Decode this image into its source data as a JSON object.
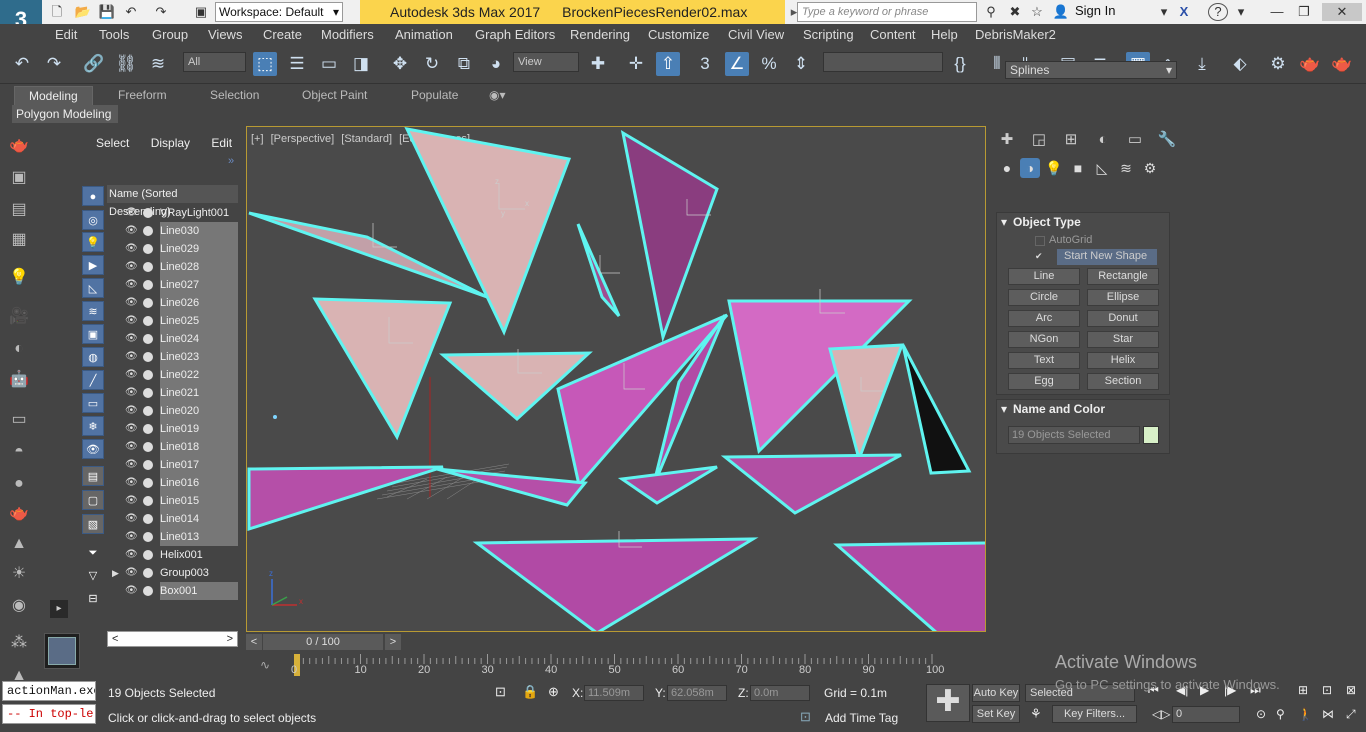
{
  "app": {
    "logo_text": "3",
    "title": "Autodesk 3ds Max 2017",
    "file": "BrockenPiecesRender02.max",
    "workspace": "Workspace: Default",
    "search_placeholder": "Type a keyword or phrase",
    "sign_in": "Sign In",
    "help": "?"
  },
  "menubar": [
    "Edit",
    "Tools",
    "Group",
    "Views",
    "Create",
    "Modifiers",
    "Animation",
    "Graph Editors",
    "Rendering",
    "Customize",
    "Civil View",
    "Scripting",
    "Content",
    "Help",
    "DebrisMaker2"
  ],
  "toolbar": {
    "selection_filter": "All",
    "ref_coord": "View",
    "named_selection": ""
  },
  "ribbon": {
    "tabs": [
      "Modeling",
      "Freeform",
      "Selection",
      "Object Paint",
      "Populate"
    ],
    "active_tab": "Modeling",
    "sub_tab": "Polygon Modeling"
  },
  "scene_explorer": {
    "tabs": [
      "Select",
      "Display",
      "Edit"
    ],
    "header": "Name (Sorted Descending)",
    "rows": [
      {
        "name": "VRayLight001",
        "selected": false
      },
      {
        "name": "Line030",
        "selected": true
      },
      {
        "name": "Line029",
        "selected": true
      },
      {
        "name": "Line028",
        "selected": true
      },
      {
        "name": "Line027",
        "selected": true
      },
      {
        "name": "Line026",
        "selected": true
      },
      {
        "name": "Line025",
        "selected": true
      },
      {
        "name": "Line024",
        "selected": true
      },
      {
        "name": "Line023",
        "selected": true
      },
      {
        "name": "Line022",
        "selected": true
      },
      {
        "name": "Line021",
        "selected": true
      },
      {
        "name": "Line020",
        "selected": true
      },
      {
        "name": "Line019",
        "selected": true
      },
      {
        "name": "Line018",
        "selected": true
      },
      {
        "name": "Line017",
        "selected": true
      },
      {
        "name": "Line016",
        "selected": true
      },
      {
        "name": "Line015",
        "selected": true
      },
      {
        "name": "Line014",
        "selected": true
      },
      {
        "name": "Line013",
        "selected": true
      },
      {
        "name": "Helix001",
        "selected": false
      },
      {
        "name": "Group003",
        "selected": false
      },
      {
        "name": "Box001",
        "selected": true
      }
    ]
  },
  "viewport": {
    "labels": [
      "[+]",
      "[Perspective]",
      "[Standard]",
      "[Edged Faces]"
    ],
    "axis_x": "x",
    "axis_y": "y",
    "axis_z": "z"
  },
  "command_panel": {
    "category": "Splines",
    "object_type_title": "Object Type",
    "autogrid": "AutoGrid",
    "start_new_shape": "Start New Shape",
    "buttons": [
      "Line",
      "Rectangle",
      "Circle",
      "Ellipse",
      "Arc",
      "Donut",
      "NGon",
      "Star",
      "Text",
      "Helix",
      "Egg",
      "Section"
    ],
    "name_color_title": "Name and Color",
    "name_value": "19 Objects Selected",
    "color": "#d8f0c8"
  },
  "timeline": {
    "frame_display": "0 / 100",
    "ticks": [
      "0",
      "10",
      "20",
      "30",
      "40",
      "50",
      "60",
      "70",
      "80",
      "90",
      "100"
    ]
  },
  "status": {
    "maxscript_line1": "actionMan.exe",
    "maxscript_line2": "-- In top-le",
    "selection": "19 Objects Selected",
    "prompt": "Click or click-and-drag to select objects",
    "x_label": "X:",
    "x_value": "11.509m",
    "y_label": "Y:",
    "y_value": "62.058m",
    "z_label": "Z:",
    "z_value": "0.0m",
    "grid": "Grid = 0.1m",
    "add_time_tag": "Add Time Tag",
    "auto_key": "Auto Key",
    "set_key": "Set Key",
    "selected": "Selected",
    "key_filters": "Key Filters...",
    "frame": "0"
  },
  "watermark": {
    "line1": "Activate Windows",
    "line2": "Go to PC settings to activate Windows."
  }
}
